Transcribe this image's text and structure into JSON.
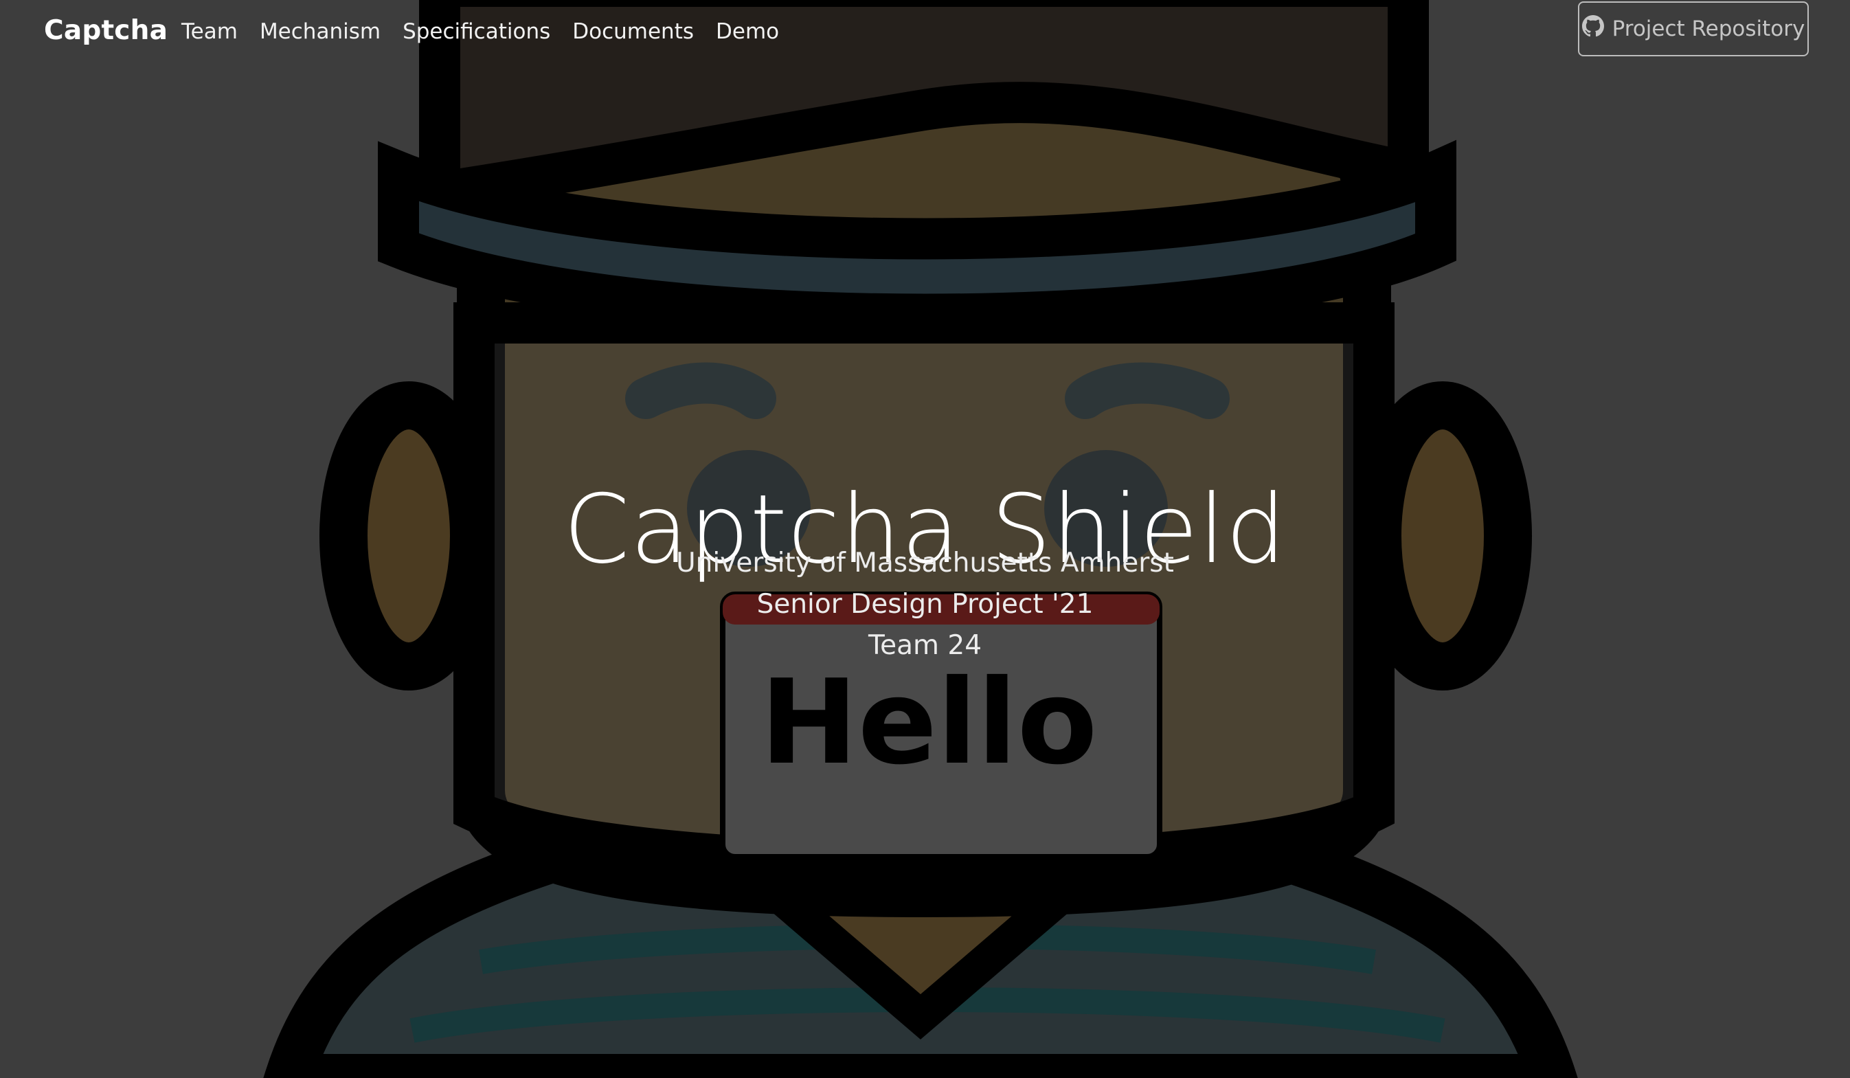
{
  "navbar": {
    "brand": "Captcha",
    "links": [
      {
        "label": "Team"
      },
      {
        "label": "Mechanism"
      },
      {
        "label": "Specifications"
      },
      {
        "label": "Documents"
      },
      {
        "label": "Demo"
      }
    ],
    "repo_button": {
      "label": "Project Repository",
      "icon": "github-icon"
    }
  },
  "hero": {
    "title": "Captcha Shield",
    "lines": [
      "University of Massachusetts Amherst",
      "Senior Design Project '21",
      "Team 24"
    ],
    "badge_text": "Hello",
    "art_description_icon": "masked-avatar-illustration"
  },
  "colors": {
    "background": "#3c3c3c",
    "outline": "#000000",
    "shield_band": "#243238",
    "nametag_header": "#5a1a18",
    "skin": "#4a3c22",
    "shirt_stripe": "#1f3a3d"
  }
}
